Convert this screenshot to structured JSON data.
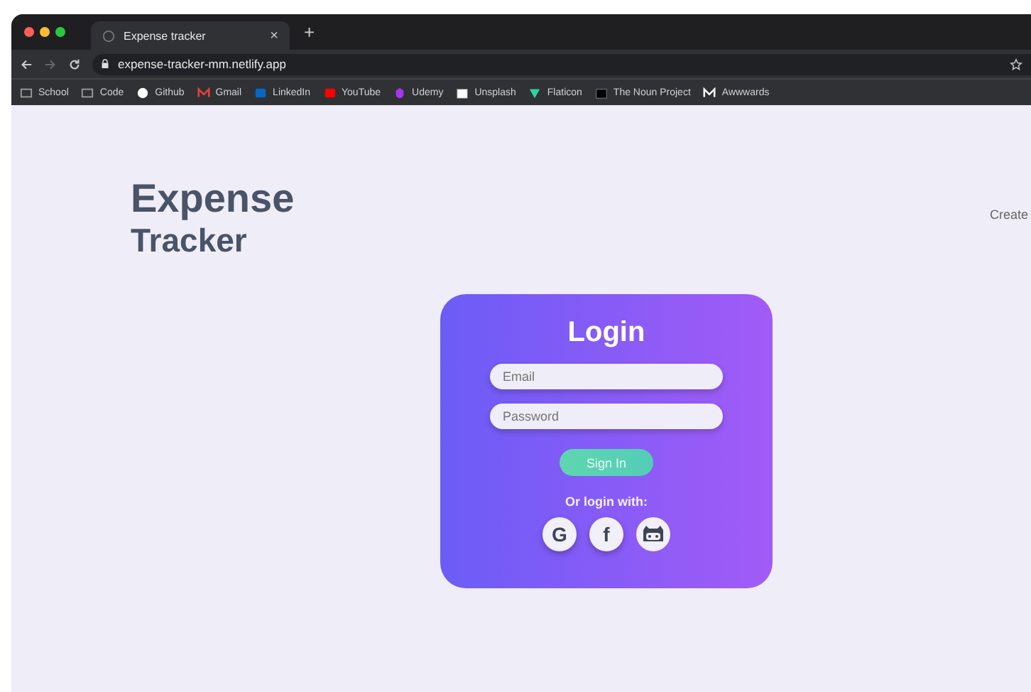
{
  "browser": {
    "tab_title": "Expense tracker",
    "tab_close": "×",
    "new_tab": "+",
    "url": "expense-tracker-mm.netlify.app"
  },
  "bookmarks": [
    {
      "label": "School",
      "kind": "folder"
    },
    {
      "label": "Code",
      "kind": "folder"
    },
    {
      "label": "Github",
      "kind": "github"
    },
    {
      "label": "Gmail",
      "kind": "mail"
    },
    {
      "label": "LinkedIn",
      "kind": "in"
    },
    {
      "label": "YouTube",
      "kind": "play"
    },
    {
      "label": "Udemy",
      "kind": "udemy"
    },
    {
      "label": "Unsplash",
      "kind": "camera"
    },
    {
      "label": "Flaticon",
      "kind": "flat"
    },
    {
      "label": "The Noun Project",
      "kind": "noun"
    },
    {
      "label": "Awwwards",
      "kind": "w"
    }
  ],
  "page": {
    "logo_line_1": "Expense",
    "logo_line_2": "Tracker",
    "nav_link": "Create"
  },
  "login": {
    "title": "Login",
    "email_placeholder": "Email",
    "password_placeholder": "Password",
    "submit": "Sign In",
    "alt_label": "Or login with:",
    "providers": [
      {
        "kind": "glyph",
        "label": "G"
      },
      {
        "kind": "glyph",
        "label": "f"
      },
      {
        "kind": "octocat"
      }
    ]
  }
}
